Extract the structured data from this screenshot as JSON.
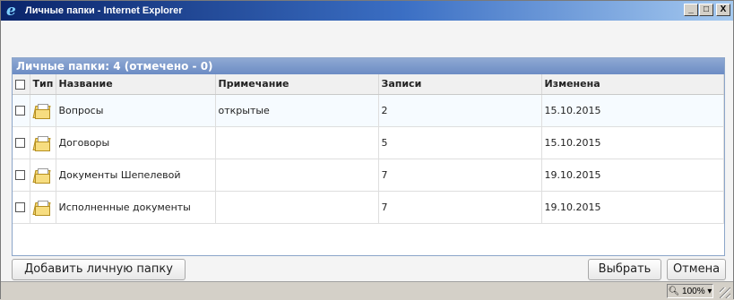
{
  "window": {
    "title": "Личные папки - Internet Explorer",
    "buttons": {
      "minimize": "_",
      "maximize": "□",
      "close": "X"
    }
  },
  "panel": {
    "title": "Личные папки: 4 (отмечено - 0)",
    "columns": [
      "Тип",
      "Название",
      "Примечание",
      "Записи",
      "Изменена"
    ],
    "rows": [
      {
        "name": "Вопросы",
        "note": "открытые",
        "records": "2",
        "modified": "15.10.2015",
        "icon": "folder-icon"
      },
      {
        "name": "Договоры",
        "note": "",
        "records": "5",
        "modified": "15.10.2015",
        "icon": "folder-icon"
      },
      {
        "name": "Документы Шепелевой",
        "note": "",
        "records": "7",
        "modified": "19.10.2015",
        "icon": "folder-icon"
      },
      {
        "name": "Исполненные документы",
        "note": "",
        "records": "7",
        "modified": "19.10.2015",
        "icon": "folder-icon"
      }
    ]
  },
  "buttons": {
    "add": "Добавить личную папку",
    "select": "Выбрать",
    "cancel": "Отмена"
  },
  "statusbar": {
    "zoom": "100%"
  },
  "colors": {
    "header": "#6c8cc4",
    "row_alt": "#f6fbff",
    "titlebar": "#0a246a"
  }
}
